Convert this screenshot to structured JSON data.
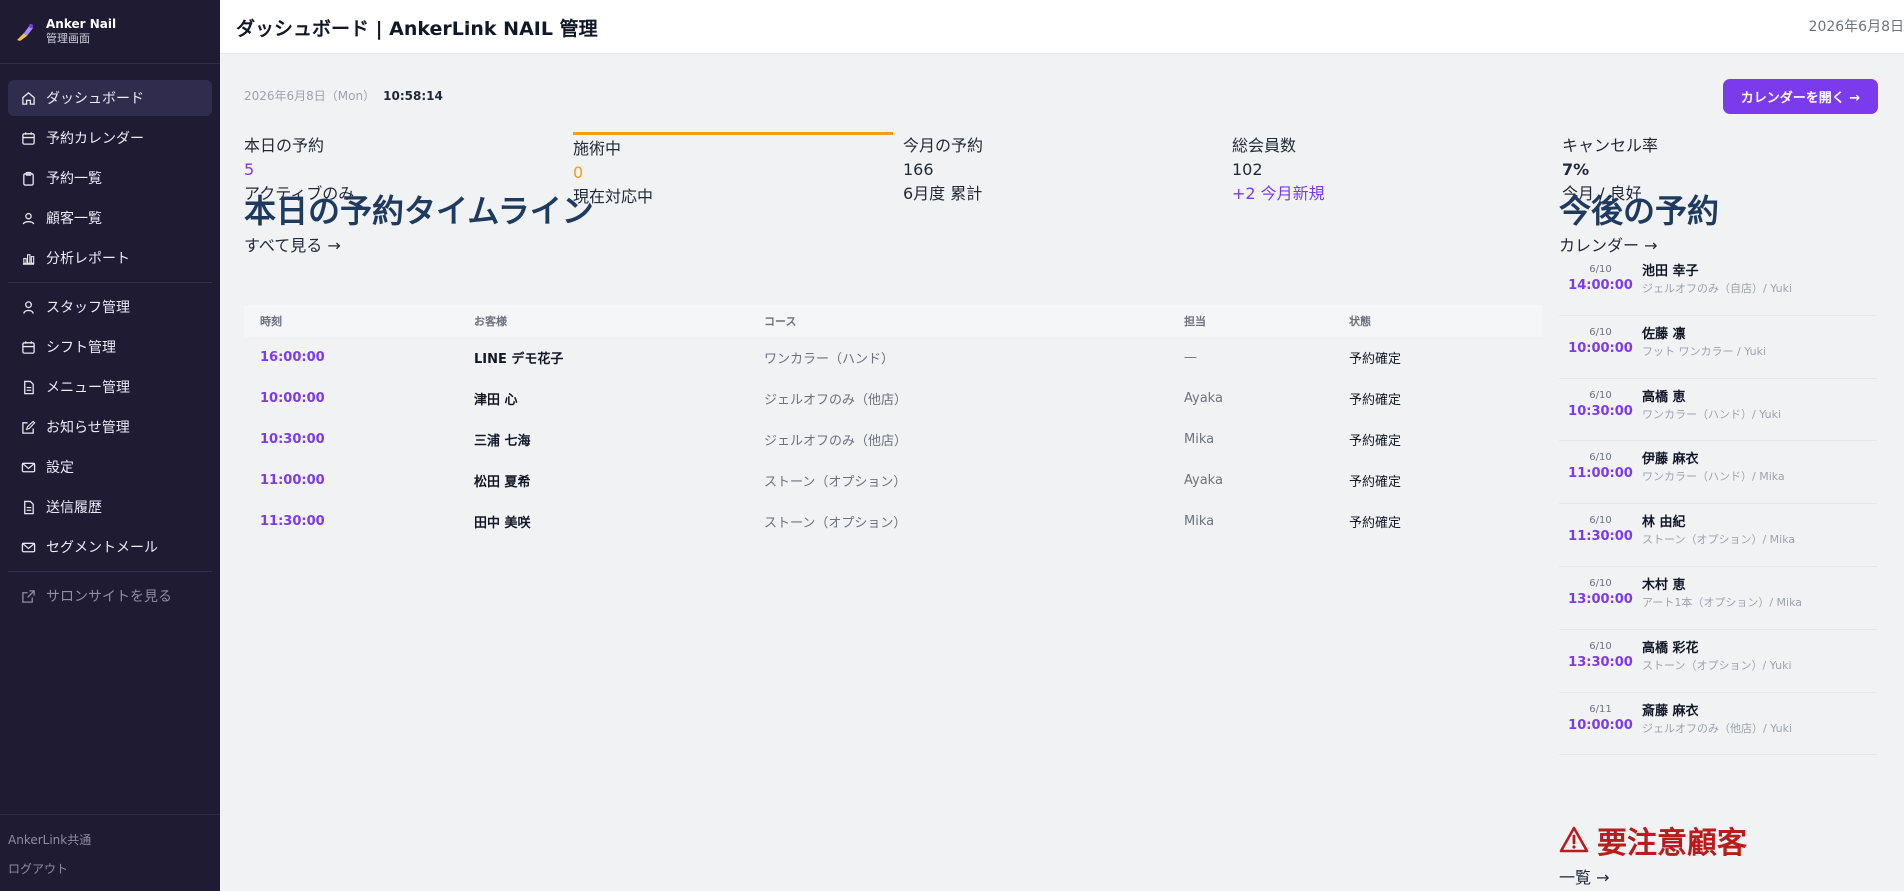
{
  "brand": {
    "name": "Anker Nail",
    "sub": "管理画面"
  },
  "sidebar": {
    "items": [
      {
        "label": "ダッシュボード",
        "icon": "home-icon",
        "active": true
      },
      {
        "label": "予約カレンダー",
        "icon": "calendar-icon"
      },
      {
        "label": "予約一覧",
        "icon": "clipboard-icon"
      },
      {
        "label": "顧客一覧",
        "icon": "users-icon"
      },
      {
        "label": "分析レポート",
        "icon": "bar-chart-icon"
      },
      {
        "label": "スタッフ管理",
        "icon": "user-icon"
      },
      {
        "label": "シフト管理",
        "icon": "calendar-icon"
      },
      {
        "label": "メニュー管理",
        "icon": "document-icon"
      },
      {
        "label": "お知らせ管理",
        "icon": "edit-icon"
      },
      {
        "label": "設定",
        "icon": "mail-icon"
      },
      {
        "label": "送信履歴",
        "icon": "document-icon"
      },
      {
        "label": "セグメントメール",
        "icon": "mail-icon"
      }
    ],
    "external": {
      "label": "サロンサイトを見る",
      "icon": "external-link-icon"
    },
    "bottom": {
      "shared": "AnkerLink共通",
      "logout": "ログアウト"
    }
  },
  "header": {
    "title": "ダッシュボード | AnkerLink NAIL 管理",
    "date": "2026年6月8日"
  },
  "main": {
    "date": "2026年6月8日（Mon）",
    "time": "10:58:14",
    "calendar_button": "カレンダーを開く →",
    "stats": [
      {
        "label": "本日の予約",
        "value": "5",
        "note": "アクティブのみ"
      },
      {
        "label": "施術中",
        "value": "0",
        "note": "現在対応中"
      },
      {
        "label": "今月の予約",
        "value": "166",
        "note": "6月度 累計"
      },
      {
        "label": "総会員数",
        "value": "102",
        "note": "+2 今月新規"
      },
      {
        "label": "キャンセル率",
        "value": "7%",
        "note": "今月 / 良好"
      }
    ],
    "timeline": {
      "title": "本日の予約タイムライン",
      "link": "すべて見る →",
      "columns": [
        "時刻",
        "お客様",
        "コース",
        "担当",
        "状態"
      ],
      "rows": [
        [
          "16:00:00",
          "LINE デモ花子",
          "ワンカラー（ハンド）",
          "—",
          "予約確定"
        ],
        [
          "10:00:00",
          "津田 心",
          "ジェルオフのみ（他店）",
          "Ayaka",
          "予約確定"
        ],
        [
          "10:30:00",
          "三浦 七海",
          "ジェルオフのみ（他店）",
          "Mika",
          "予約確定"
        ],
        [
          "11:00:00",
          "松田 夏希",
          "ストーン（オプション）",
          "Ayaka",
          "予約確定"
        ],
        [
          "11:30:00",
          "田中 美咲",
          "ストーン（オプション）",
          "Mika",
          "予約確定"
        ]
      ]
    },
    "upcoming": {
      "title": "今後の予約",
      "link": "カレンダー →",
      "items": [
        {
          "date": "6/10",
          "time": "14:00:00",
          "name": "池田 幸子",
          "course": "ジェルオフのみ（自店）/ Yuki"
        },
        {
          "date": "6/10",
          "time": "10:00:00",
          "name": "佐藤 凛",
          "course": "フット ワンカラー / Yuki"
        },
        {
          "date": "6/10",
          "time": "10:30:00",
          "name": "高橋 恵",
          "course": "ワンカラー（ハンド）/ Yuki"
        },
        {
          "date": "6/10",
          "time": "11:00:00",
          "name": "伊藤 麻衣",
          "course": "ワンカラー（ハンド）/ Mika"
        },
        {
          "date": "6/10",
          "time": "11:30:00",
          "name": "林 由紀",
          "course": "ストーン（オプション）/ Mika"
        },
        {
          "date": "6/10",
          "time": "13:00:00",
          "name": "木村 恵",
          "course": "アート1本（オプション）/ Mika"
        },
        {
          "date": "6/10",
          "time": "13:30:00",
          "name": "高橋 彩花",
          "course": "ストーン（オプション）/ Yuki"
        },
        {
          "date": "6/11",
          "time": "10:00:00",
          "name": "斎藤 麻衣",
          "course": "ジェルオフのみ（他店）/ Yuki"
        }
      ]
    },
    "warning": {
      "title": "要注意顧客",
      "link": "一覧 →",
      "icon": "warning-icon"
    }
  },
  "colors": {
    "accent": "#7c3aed",
    "sidebar": "#1e1b33",
    "title": "#1e3a5f",
    "warning": "#b91c1c",
    "in_progress": "#f59e0b"
  }
}
